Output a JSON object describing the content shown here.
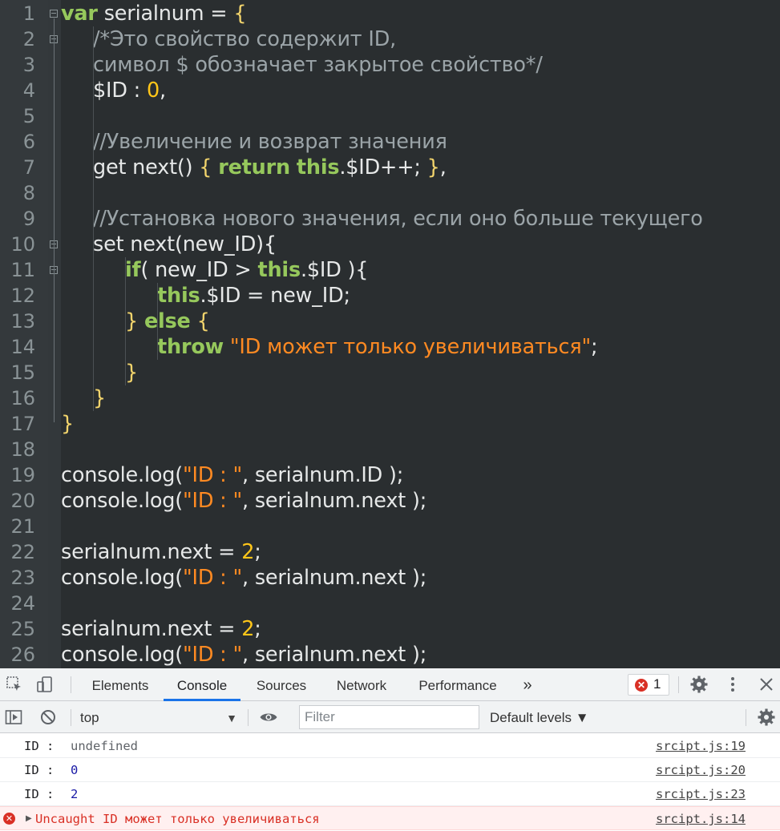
{
  "editor": {
    "lines": [
      {
        "n": "1",
        "indent": 0,
        "tokens": [
          [
            "kw",
            "var"
          ],
          [
            "plain",
            " serialnum = "
          ],
          [
            "brace",
            "{"
          ]
        ],
        "fold": true
      },
      {
        "n": "2",
        "indent": 1,
        "tokens": [
          [
            "cmt",
            "/*Это свойство содержит ID,"
          ]
        ],
        "fold": true
      },
      {
        "n": "3",
        "indent": 1,
        "tokens": [
          [
            "cmt",
            "символ $ обозначает закрытое свойство*/"
          ]
        ]
      },
      {
        "n": "4",
        "indent": 1,
        "tokens": [
          [
            "plain",
            "$ID : "
          ],
          [
            "num",
            "0"
          ],
          [
            "plain",
            ","
          ]
        ]
      },
      {
        "n": "5",
        "indent": 0,
        "tokens": []
      },
      {
        "n": "6",
        "indent": 1,
        "tokens": [
          [
            "cmt",
            "//Увеличение и возврат значения"
          ]
        ]
      },
      {
        "n": "7",
        "indent": 1,
        "tokens": [
          [
            "plain",
            "get next() "
          ],
          [
            "brace",
            "{"
          ],
          [
            "plain",
            " "
          ],
          [
            "kw",
            "return"
          ],
          [
            "plain",
            " "
          ],
          [
            "kw",
            "this"
          ],
          [
            "plain",
            ".$ID++; "
          ],
          [
            "brace",
            "}"
          ],
          [
            "plain",
            ","
          ]
        ]
      },
      {
        "n": "8",
        "indent": 0,
        "tokens": []
      },
      {
        "n": "9",
        "indent": 1,
        "tokens": [
          [
            "cmt",
            "//Установка нового значения, если оно больше текущего"
          ]
        ]
      },
      {
        "n": "10",
        "indent": 1,
        "tokens": [
          [
            "plain",
            "set next(new_ID){"
          ]
        ],
        "fold": true
      },
      {
        "n": "11",
        "indent": 2,
        "tokens": [
          [
            "kw",
            "if"
          ],
          [
            "plain",
            "( new_ID > "
          ],
          [
            "kw",
            "this"
          ],
          [
            "plain",
            ".$ID ){"
          ]
        ],
        "fold": true
      },
      {
        "n": "12",
        "indent": 3,
        "tokens": [
          [
            "kw",
            "this"
          ],
          [
            "plain",
            ".$ID = new_ID;"
          ]
        ]
      },
      {
        "n": "13",
        "indent": 2,
        "tokens": [
          [
            "brace",
            "}"
          ],
          [
            "plain",
            " "
          ],
          [
            "kw",
            "else"
          ],
          [
            "plain",
            " "
          ],
          [
            "brace",
            "{"
          ]
        ]
      },
      {
        "n": "14",
        "indent": 3,
        "tokens": [
          [
            "kw",
            "throw"
          ],
          [
            "plain",
            " "
          ],
          [
            "str",
            "\"ID может только увеличиваться\""
          ],
          [
            "plain",
            ";"
          ]
        ]
      },
      {
        "n": "15",
        "indent": 2,
        "tokens": [
          [
            "brace",
            "}"
          ]
        ]
      },
      {
        "n": "16",
        "indent": 1,
        "tokens": [
          [
            "brace",
            "}"
          ]
        ]
      },
      {
        "n": "17",
        "indent": 0,
        "tokens": [
          [
            "brace",
            "}"
          ]
        ]
      },
      {
        "n": "18",
        "indent": 0,
        "tokens": []
      },
      {
        "n": "19",
        "indent": 0,
        "tokens": [
          [
            "plain",
            "console.log("
          ],
          [
            "str",
            "\"ID : \""
          ],
          [
            "plain",
            ", serialnum.ID );"
          ]
        ]
      },
      {
        "n": "20",
        "indent": 0,
        "tokens": [
          [
            "plain",
            "console.log("
          ],
          [
            "str",
            "\"ID : \""
          ],
          [
            "plain",
            ", serialnum.next );"
          ]
        ]
      },
      {
        "n": "21",
        "indent": 0,
        "tokens": []
      },
      {
        "n": "22",
        "indent": 0,
        "tokens": [
          [
            "plain",
            "serialnum.next = "
          ],
          [
            "num",
            "2"
          ],
          [
            "plain",
            ";"
          ]
        ]
      },
      {
        "n": "23",
        "indent": 0,
        "tokens": [
          [
            "plain",
            "console.log("
          ],
          [
            "str",
            "\"ID : \""
          ],
          [
            "plain",
            ", serialnum.next );"
          ]
        ]
      },
      {
        "n": "24",
        "indent": 0,
        "tokens": []
      },
      {
        "n": "25",
        "indent": 0,
        "tokens": [
          [
            "plain",
            "serialnum.next = "
          ],
          [
            "num",
            "2"
          ],
          [
            "plain",
            ";"
          ]
        ]
      },
      {
        "n": "26",
        "indent": 0,
        "tokens": [
          [
            "plain",
            "console.log("
          ],
          [
            "str",
            "\"ID : \""
          ],
          [
            "plain",
            ", serialnum.next );"
          ]
        ]
      }
    ]
  },
  "devtools": {
    "tabs": [
      "Elements",
      "Console",
      "Sources",
      "Network",
      "Performance"
    ],
    "active_tab": "Console",
    "more_tabs": "»",
    "error_count": "1",
    "context": "top",
    "filter_placeholder": "Filter",
    "levels_label": "Default levels ▼",
    "messages": [
      {
        "label": "ID : ",
        "value": "undefined",
        "value_color": "#5f6368",
        "source": "srcipt.js:19"
      },
      {
        "label": "ID : ",
        "value": "0",
        "value_color": "#1a1aa6",
        "source": "srcipt.js:20"
      },
      {
        "label": "ID : ",
        "value": "2",
        "value_color": "#1a1aa6",
        "source": "srcipt.js:23"
      }
    ],
    "error": {
      "text": "Uncaught ID может только увеличиваться",
      "source": "srcipt.js:14"
    }
  }
}
